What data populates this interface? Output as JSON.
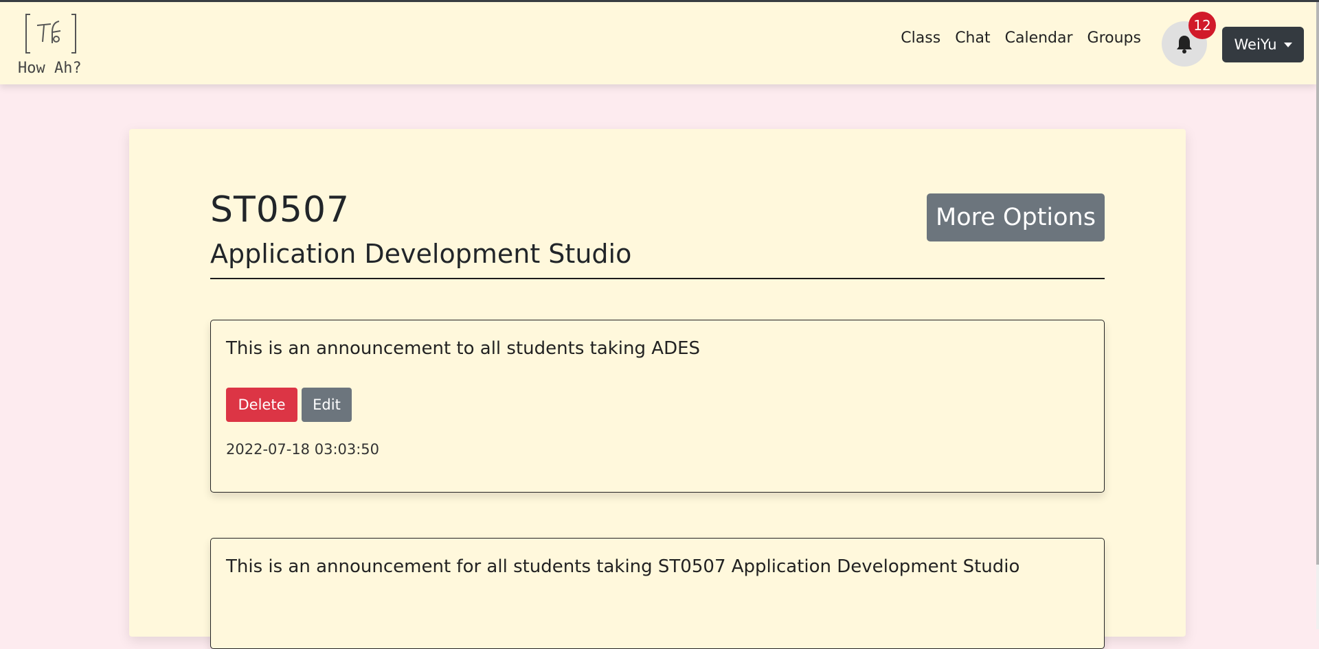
{
  "app": {
    "logo_text": "How Ah?"
  },
  "nav": {
    "links": [
      "Class",
      "Chat",
      "Calendar",
      "Groups"
    ],
    "notification_count": "12",
    "user_label": "WeiYu"
  },
  "module": {
    "code": "ST0507",
    "name": "Application Development Studio",
    "more_options_label": "More Options"
  },
  "announcements": [
    {
      "text": "This is an announcement to all students taking ADES",
      "delete_label": "Delete",
      "edit_label": "Edit",
      "timestamp": "2022-07-18 03:03:50"
    },
    {
      "text": "This is an announcement for all students taking ST0507 Application Development Studio"
    }
  ],
  "colors": {
    "page_bg": "#fdebef",
    "surface": "#fff8dc",
    "danger": "#dc3545",
    "secondary": "#6c757d",
    "dark": "#343a40",
    "badge": "#d11a2a"
  },
  "icons": {
    "bell": "bell-icon",
    "caret": "caret-down-icon",
    "logo": "logo-icon"
  }
}
